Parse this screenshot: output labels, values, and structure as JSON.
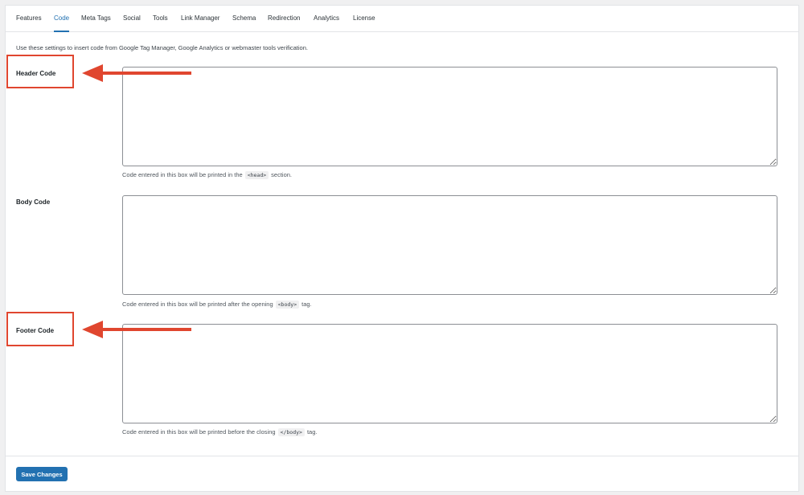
{
  "tabs": [
    {
      "label": "Features"
    },
    {
      "label": "Code",
      "active": true
    },
    {
      "label": "Meta Tags"
    },
    {
      "label": "Social"
    },
    {
      "label": "Tools"
    },
    {
      "label": "Link Manager"
    },
    {
      "label": "Schema"
    },
    {
      "label": "Redirection"
    },
    {
      "label": "Analytics"
    },
    {
      "label": "License"
    }
  ],
  "intro_text": "Use these settings to insert code from Google Tag Manager, Google Analytics or webmaster tools verification.",
  "fields": {
    "header": {
      "label": "Header Code",
      "value": "",
      "desc_before": "Code entered in this box will be printed in the",
      "desc_tag": "<head>",
      "desc_after": "section."
    },
    "body": {
      "label": "Body Code",
      "value": "",
      "desc_before": "Code entered in this box will be printed after the opening",
      "desc_tag": "<body>",
      "desc_after": "tag."
    },
    "footer": {
      "label": "Footer Code",
      "value": "",
      "desc_before": "Code entered in this box will be printed before the closing",
      "desc_tag": "</body>",
      "desc_after": "tag."
    }
  },
  "save_label": "Save Changes",
  "colors": {
    "accent": "#2271b1",
    "annotation": "#e0462f"
  },
  "annotations": [
    {
      "target": "header-code-label",
      "icon": "arrow-left-icon"
    },
    {
      "target": "footer-code-label",
      "icon": "arrow-left-icon"
    }
  ]
}
